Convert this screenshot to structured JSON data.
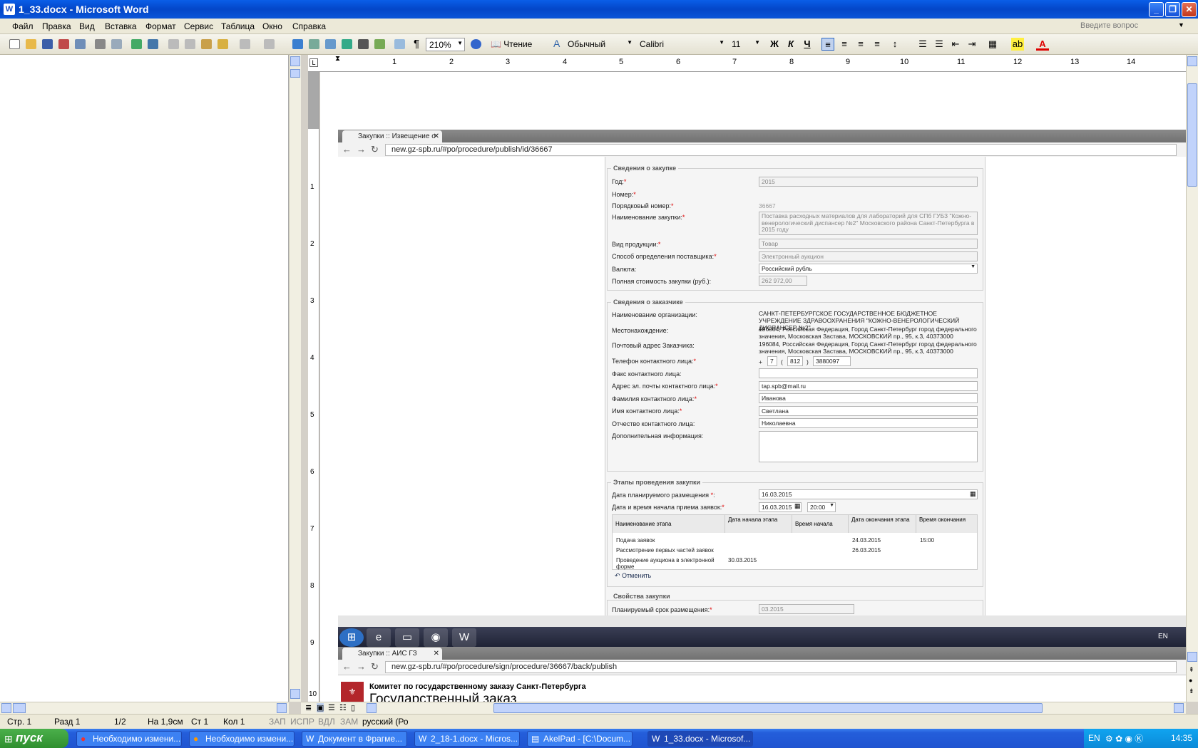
{
  "window": {
    "title": "1_33.docx - Microsoft Word",
    "min": "_",
    "max": "❐",
    "close": "✕"
  },
  "menu": [
    "Файл",
    "Правка",
    "Вид",
    "Вставка",
    "Формат",
    "Сервис",
    "Таблица",
    "Окно",
    "Справка"
  ],
  "help_placeholder": "Введите вопрос",
  "toolbar": {
    "zoom": "210%",
    "reading": "Чтение",
    "style": "Обычный",
    "font": "Calibri",
    "size": "11",
    "bold": "Ж",
    "italic": "К",
    "underline": "Ч"
  },
  "ruler": [
    "1",
    "2",
    "3",
    "4",
    "5",
    "6",
    "7",
    "8",
    "9",
    "10",
    "11",
    "12",
    "13",
    "14"
  ],
  "vruler": [
    "1",
    "2",
    "3",
    "4",
    "5",
    "6",
    "7",
    "8",
    "9",
    "10"
  ],
  "browser1": {
    "tab": "Закупки :: Извещение о",
    "url": "new.gz-spb.ru/#po/procedure/publish/id/36667"
  },
  "browser2": {
    "tab": "Закупки :: АИС ГЗ",
    "url": "new.gz-spb.ru/#po/procedure/sign/procedure/36667/back/publish"
  },
  "form": {
    "s1": "Сведения о закупке",
    "year_l": "Год:",
    "year_v": "2015",
    "num_l": "Номер:",
    "ord_l": "Порядковый номер:",
    "ord_v": "36667",
    "name_l": "Наименование закупки:",
    "name_v": "Поставка расходных материалов для лабораторий для СПб ГУБЗ \"Кожно-венерологический диспансер №2\" Московского района Санкт-Петербурга в 2015 году",
    "prod_l": "Вид продукции:",
    "prod_v": "Товар",
    "meth_l": "Способ определения поставщика:",
    "meth_v": "Электронный аукцион",
    "cur_l": "Валюта:",
    "cur_v": "Российский рубль",
    "cost_l": "Полная стоимость закупки (руб.):",
    "cost_v": "262 972,00",
    "s2": "Сведения о заказчике",
    "org_l": "Наименование организации:",
    "org_v": "САНКТ-ПЕТЕРБУРГСКОЕ ГОСУДАРСТВЕННОЕ БЮДЖЕТНОЕ УЧРЕЖДЕНИЕ ЗДРАВООХРАНЕНИЯ \"КОЖНО-ВЕНЕРОЛОГИЧЕСКИЙ ДИСПАНСЕР №2\"",
    "loc_l": "Местонахождение:",
    "loc_v": "196084, Российская Федерация, Город Санкт-Петербург город федерального значения, Московская Застава, МОСКОВСКИЙ пр., 95, к.3, 40373000",
    "post_l": "Почтовый адрес Заказчика:",
    "post_v": "196084, Российская Федерация, Город Санкт-Петербург город федерального значения, Московская Застава, МОСКОВСКИЙ пр., 95, к.3, 40373000",
    "tel_l": "Телефон контактного лица:",
    "tel_plus": "+",
    "tel_c": "7",
    "tel_code": "812",
    "tel_num": "3880097",
    "fax_l": "Факс контактного лица:",
    "mail_l": "Адрес эл. почты контактного лица:",
    "mail_v": "tap.spb@mail.ru",
    "fam_l": "Фамилия контактного лица:",
    "fam_v": "Иванова",
    "im_l": "Имя контактного лица:",
    "im_v": "Светлана",
    "ot_l": "Отчество контактного лица:",
    "ot_v": "Николаевна",
    "add_l": "Дополнительная информация:",
    "s3": "Этапы проведения закупки",
    "plan_l": "Дата планируемого размещения",
    "plan_v": "16.03.2015",
    "start_l": "Дата и время начала приема заявок:",
    "start_v": "16.03.2015",
    "start_t": "20:00",
    "th": [
      "Наименование этапа",
      "Дата начала этапа",
      "Время начала",
      "Дата окончания этапа",
      "Время окончания"
    ],
    "rows": [
      [
        "Подача заявок",
        "",
        "",
        "24.03.2015",
        "15:00"
      ],
      [
        "Рассмотрение первых частей заявок",
        "",
        "",
        "26.03.2015",
        ""
      ],
      [
        "Проведение аукциона в электронной форме",
        "30.03.2015",
        "",
        "",
        ""
      ]
    ],
    "cancel": "Отменить",
    "s4": "Свойства закупки",
    "term_l": "Планируемый срок размещения:",
    "term_v": "03.2015"
  },
  "committee": "Комитет по государственному заказу Санкт-Петербурга",
  "gz": "Государственный заказ",
  "lang_inner": "EN",
  "status": {
    "page": "Стр. 1",
    "sect": "Разд 1",
    "pages": "1/2",
    "at": "На 1,9см",
    "line": "Ст 1",
    "col": "Кол 1",
    "rec": "ЗАП",
    "trk": "ИСПР",
    "ext": "ВДЛ",
    "ovr": "ЗАМ",
    "lang": "русский (Ро"
  },
  "taskbar": {
    "start": "пуск",
    "items": [
      "Необходимо измени...",
      "Необходимо измени...",
      "Документ в Фрагме...",
      "2_18-1.docx - Micros...",
      "AkelPad - [C:\\Docum...",
      "1_33.docx - Microsof..."
    ],
    "lang": "EN",
    "clock": "14:35"
  }
}
